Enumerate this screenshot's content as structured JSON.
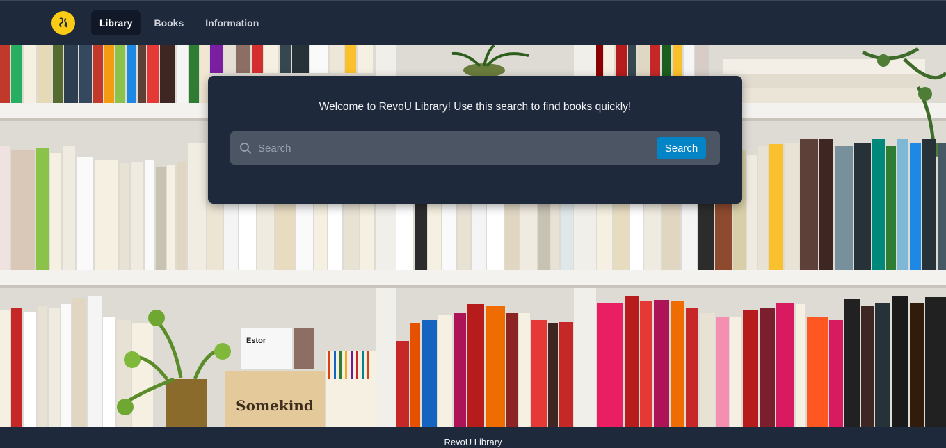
{
  "navbar": {
    "logo_icon": "revou-logo-icon",
    "items": [
      {
        "label": "Library",
        "active": true
      },
      {
        "label": "Books",
        "active": false
      },
      {
        "label": "Information",
        "active": false
      }
    ]
  },
  "hero": {
    "background_image": "bookshelf-photo",
    "sign_text": "Somekind",
    "book_text": "Estor"
  },
  "search": {
    "welcome_text": "Welcome to RevoU Library! Use this search to find books quickly!",
    "placeholder": "Search",
    "value": "",
    "button_label": "Search",
    "button_color": "#0284c7"
  },
  "footer": {
    "text": "RevoU Library"
  },
  "colors": {
    "navbar_bg": "#1e293b",
    "accent": "#0284c7",
    "logo": "#facc15"
  }
}
